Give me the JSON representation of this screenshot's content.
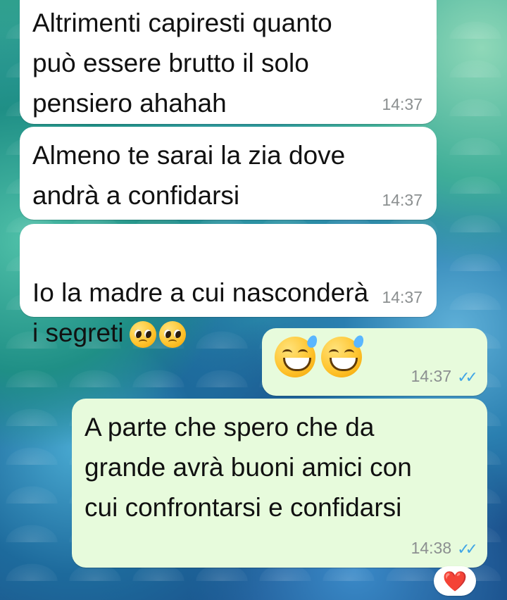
{
  "messages": [
    {
      "direction": "incoming",
      "text": "Altrimenti capiresti quanto\npuò essere brutto il solo\npensiero ahahah",
      "time": "14:37"
    },
    {
      "direction": "incoming",
      "text": "Almeno te sarai la zia dove\nandrà a confidarsi",
      "time": "14:37"
    },
    {
      "direction": "incoming",
      "text": "Io la madre a cui nasconderà\ni segreti",
      "time": "14:37",
      "emoji": "🥺🥺"
    },
    {
      "direction": "outgoing",
      "text": "😅😅",
      "time": "14:37",
      "status": "read"
    },
    {
      "direction": "outgoing",
      "text": "A parte che spero che da\ngrande avrà buoni amici con\ncui confrontarsi e confidarsi",
      "time": "14:38",
      "status": "read",
      "reaction": "❤️"
    }
  ],
  "colors": {
    "incoming_bubble": "#ffffff",
    "outgoing_bubble": "#e7fbdc",
    "read_ticks": "#42a6e6",
    "timestamp": "#8b8f90"
  }
}
